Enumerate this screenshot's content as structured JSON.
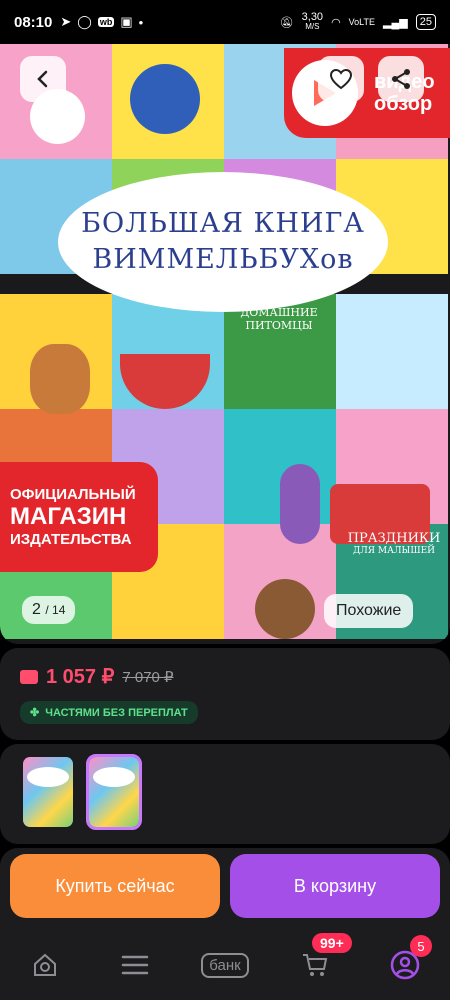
{
  "status_bar": {
    "time": "08:10",
    "network_speed": "3,30",
    "network_unit": "M/S",
    "battery": "25",
    "wb_badge": "wb"
  },
  "gallery": {
    "cover_title_line1": "БОЛЬШАЯ КНИГА",
    "cover_title_line2": "ВИММЕЛЬБУХов",
    "promo_line1": "ОФИЦИАЛЬНЫЙ",
    "promo_line2": "МАГАЗИН",
    "promo_line3": "ИЗДАТЕЛЬСТВА",
    "subtitle_pets_line1": "ДОМАШНИЕ",
    "subtitle_pets_line2": "ПИТОМЦЫ",
    "subtitle_holidays_line1": "ПРАЗДНИКИ",
    "subtitle_holidays_line2": "ДЛЯ МАЛЫШЕЙ",
    "video_label_line1": "видео",
    "video_label_line2": "обзор",
    "page_current": "2",
    "page_total": "/ 14",
    "similar_label": "Похожие"
  },
  "price": {
    "current": "1 057 ₽",
    "old": "7 070 ₽",
    "installment_label": "ЧАСТЯМИ БЕЗ ПЕРЕПЛАТ"
  },
  "variants": {
    "thumb_text": "БОЛЬШАЯ КНИГА ВИММЕЛЬБУХОВ"
  },
  "actions": {
    "buy_now": "Купить сейчас",
    "add_to_cart": "В корзину"
  },
  "bottom_nav": {
    "bank_label": "банк",
    "cart_badge": "99+",
    "profile_badge": "5"
  },
  "colors": {
    "accent_purple": "#a54fe9",
    "accent_orange": "#f98d3a",
    "price_pink": "#ff4d6d",
    "promo_red": "#e3262b"
  }
}
